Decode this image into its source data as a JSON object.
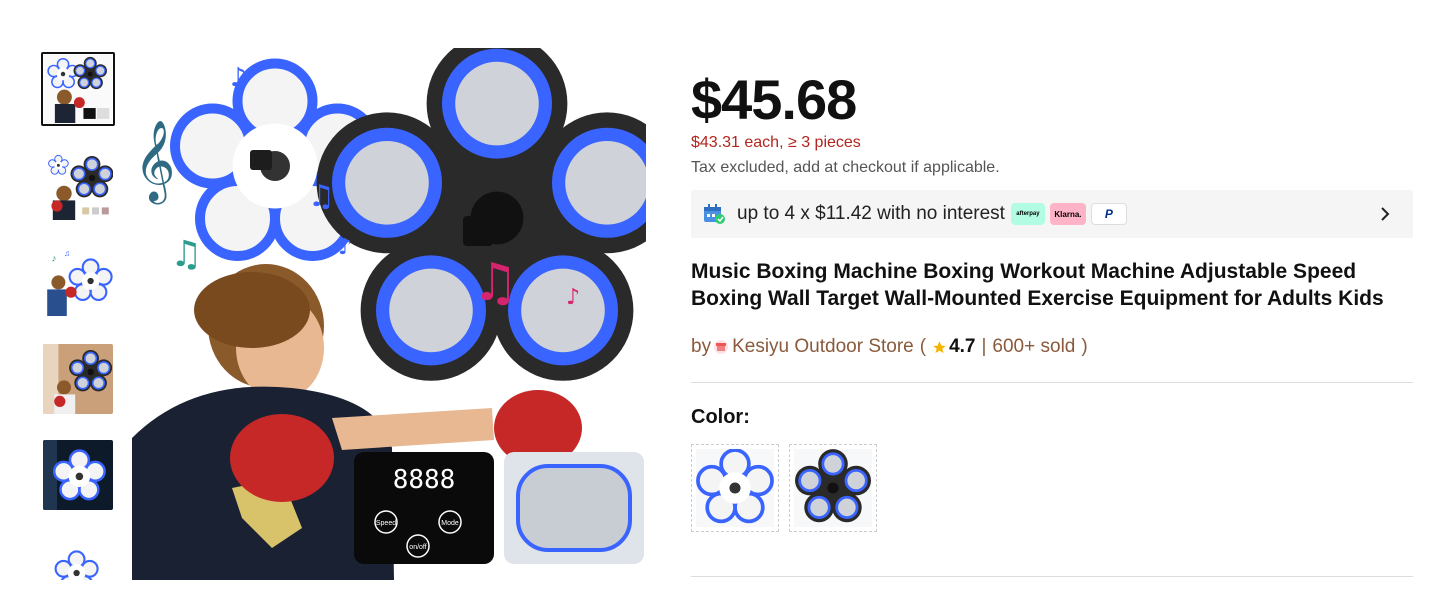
{
  "gallery": {
    "thumbnails": [
      {
        "name": "thumbnail-1",
        "active": true
      },
      {
        "name": "thumbnail-2",
        "active": false
      },
      {
        "name": "thumbnail-3",
        "active": false
      },
      {
        "name": "thumbnail-4",
        "active": false
      },
      {
        "name": "thumbnail-5",
        "active": false
      },
      {
        "name": "thumbnail-6",
        "active": false
      }
    ],
    "main_image": {
      "display_digits": "8888",
      "button_speed": "Speed",
      "button_mode": "Mode",
      "button_onoff": "on/off"
    }
  },
  "product": {
    "price": "$45.68",
    "bulk_price": "$43.31 each, ≥ 3 pieces",
    "tax_note": "Tax excluded, add at checkout if applicable.",
    "installment": {
      "text": "up to 4 x $11.42 with no interest",
      "providers": [
        "afterpay",
        "Klarna.",
        "P"
      ]
    },
    "title": "Music Boxing Machine Boxing Workout Machine Adjustable Speed Boxing Wall Target Wall-Mounted Exercise Equipment for Adults Kids",
    "seller": {
      "by": "by",
      "store_name": "Kesiyu Outdoor Store",
      "open_paren": "(",
      "rating": "4.7",
      "separator": "|",
      "sold": "600+ sold",
      "close_paren": ")"
    },
    "color_label": "Color:",
    "colors": [
      "white",
      "black"
    ]
  },
  "colors": {
    "price_red": "#b3261e",
    "seller_brown": "#8a5a3c",
    "led_blue": "#2f5bff",
    "star_gold": "#f5b400"
  },
  "icons": {
    "installment": "calendar-icon",
    "chevron": "chevron-right-icon",
    "star": "star-icon",
    "store": "store-icon"
  }
}
